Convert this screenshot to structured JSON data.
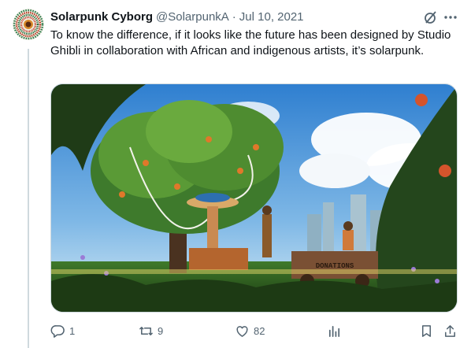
{
  "author": {
    "name": "Solarpunk Cyborg",
    "handle": "@SolarpunkA",
    "separator": "·",
    "date": "Jul 10, 2021"
  },
  "tweet": {
    "text": "To know the difference, if it looks like the future has been designed by Studio Ghibli in collaboration with African and indigenous artists, it’s solarpunk."
  },
  "media": {
    "sign_text": "DONATIONS"
  },
  "actions": {
    "replies": "1",
    "reposts": "9",
    "likes": "82"
  },
  "icons": [
    "avatar-image",
    "grok-icon",
    "more-icon",
    "reply-icon",
    "repost-icon",
    "like-icon",
    "views-icon",
    "bookmark-icon",
    "share-icon"
  ],
  "colors": {
    "text": "#0f1419",
    "secondary": "#536471",
    "divider": "#cfd9de"
  }
}
